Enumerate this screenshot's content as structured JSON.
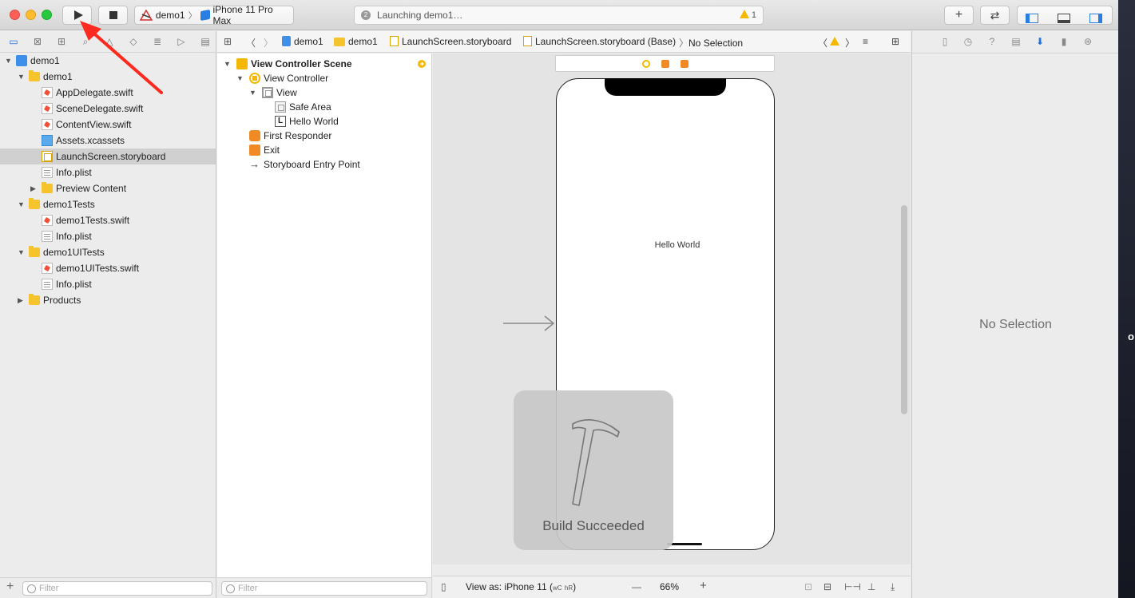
{
  "toolbar": {
    "scheme": {
      "project": "demo1",
      "device": "iPhone 11 Pro Max"
    },
    "status": {
      "text": "Launching demo1…",
      "spinner_text": "2",
      "warning_count": "1"
    },
    "add_label": "+",
    "swap_label": "⇄"
  },
  "navigator": {
    "tree": [
      {
        "label": "demo1",
        "level": 0,
        "icon": "project-icon",
        "disclosure": "open"
      },
      {
        "label": "demo1",
        "level": 1,
        "icon": "folder-icon",
        "disclosure": "open"
      },
      {
        "label": "AppDelegate.swift",
        "level": 2,
        "icon": "swift-file-icon"
      },
      {
        "label": "SceneDelegate.swift",
        "level": 2,
        "icon": "swift-file-icon"
      },
      {
        "label": "ContentView.swift",
        "level": 2,
        "icon": "swift-file-icon"
      },
      {
        "label": "Assets.xcassets",
        "level": 2,
        "icon": "assets-icon"
      },
      {
        "label": "LaunchScreen.storyboard",
        "level": 2,
        "icon": "storyboard-icon",
        "selected": true
      },
      {
        "label": "Info.plist",
        "level": 2,
        "icon": "plist-icon"
      },
      {
        "label": "Preview Content",
        "level": 2,
        "icon": "folder-icon",
        "disclosure": "closed"
      },
      {
        "label": "demo1Tests",
        "level": 1,
        "icon": "folder-icon",
        "disclosure": "open"
      },
      {
        "label": "demo1Tests.swift",
        "level": 2,
        "icon": "swift-file-icon"
      },
      {
        "label": "Info.plist",
        "level": 2,
        "icon": "plist-icon"
      },
      {
        "label": "demo1UITests",
        "level": 1,
        "icon": "folder-icon",
        "disclosure": "open"
      },
      {
        "label": "demo1UITests.swift",
        "level": 2,
        "icon": "swift-file-icon"
      },
      {
        "label": "Info.plist",
        "level": 2,
        "icon": "plist-icon"
      },
      {
        "label": "Products",
        "level": 1,
        "icon": "folder-icon",
        "disclosure": "closed"
      }
    ],
    "filter_placeholder": "Filter"
  },
  "jumpbar": {
    "crumbs": [
      "demo1",
      "demo1",
      "LaunchScreen.storyboard",
      "LaunchScreen.storyboard (Base)",
      "No Selection"
    ]
  },
  "outline": {
    "items": [
      {
        "label": "View Controller Scene",
        "level": 0,
        "icon": "scene-icon",
        "bold": true
      },
      {
        "label": "View Controller",
        "level": 1,
        "icon": "view-controller-icon"
      },
      {
        "label": "View",
        "level": 2,
        "icon": "view-icon"
      },
      {
        "label": "Safe Area",
        "level": 3,
        "icon": "safe-area-icon"
      },
      {
        "label": "Hello World",
        "level": 3,
        "icon": "label-icon"
      },
      {
        "label": "First Responder",
        "level": 1,
        "icon": "first-responder-icon"
      },
      {
        "label": "Exit",
        "level": 1,
        "icon": "exit-icon"
      },
      {
        "label": "Storyboard Entry Point",
        "level": 1,
        "icon": "entry-point-icon"
      }
    ],
    "label_glyph": "L",
    "filter_placeholder": "Filter"
  },
  "canvas": {
    "label_text": "Hello World",
    "hud_text": "Build Succeeded"
  },
  "canvas_bar": {
    "view_as": "View as: iPhone 11",
    "size_class_w": "wC",
    "size_class_h": "hR",
    "size_close": ")",
    "zoom_out": "—",
    "zoom": "66%",
    "zoom_in": "+"
  },
  "inspector": {
    "empty_text": "No Selection"
  },
  "desktop": {
    "edge_text": "o"
  }
}
